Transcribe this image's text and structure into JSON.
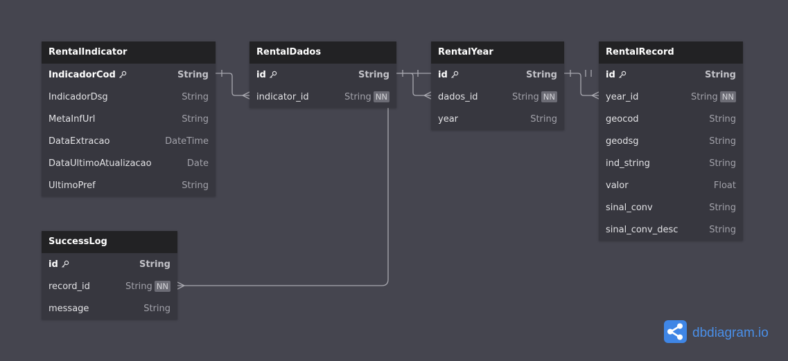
{
  "tables": [
    {
      "name": "RentalIndicator",
      "fields": [
        {
          "name": "IndicadorCod",
          "type": "String",
          "pk": true
        },
        {
          "name": "IndicadorDsg",
          "type": "String"
        },
        {
          "name": "MetaInfUrl",
          "type": "String"
        },
        {
          "name": "DataExtracao",
          "type": "DateTime"
        },
        {
          "name": "DataUltimoAtualizacao",
          "type": "Date"
        },
        {
          "name": "UltimoPref",
          "type": "String"
        }
      ]
    },
    {
      "name": "RentalDados",
      "fields": [
        {
          "name": "id",
          "type": "String",
          "pk": true
        },
        {
          "name": "indicator_id",
          "type": "String",
          "nn": "NN"
        }
      ]
    },
    {
      "name": "RentalYear",
      "fields": [
        {
          "name": "id",
          "type": "String",
          "pk": true
        },
        {
          "name": "dados_id",
          "type": "String",
          "nn": "NN"
        },
        {
          "name": "year",
          "type": "String"
        }
      ]
    },
    {
      "name": "RentalRecord",
      "fields": [
        {
          "name": "id",
          "type": "String",
          "pk": true
        },
        {
          "name": "year_id",
          "type": "String",
          "nn": "NN"
        },
        {
          "name": "geocod",
          "type": "String"
        },
        {
          "name": "geodsg",
          "type": "String"
        },
        {
          "name": "ind_string",
          "type": "String"
        },
        {
          "name": "valor",
          "type": "Float"
        },
        {
          "name": "sinal_conv",
          "type": "String"
        },
        {
          "name": "sinal_conv_desc",
          "type": "String"
        }
      ]
    },
    {
      "name": "SuccessLog",
      "fields": [
        {
          "name": "id",
          "type": "String",
          "pk": true
        },
        {
          "name": "record_id",
          "type": "String",
          "nn": "NN"
        },
        {
          "name": "message",
          "type": "String"
        }
      ]
    }
  ],
  "relationships": [
    {
      "from": "RentalIndicator.IndicadorCod",
      "to": "RentalDados.indicator_id",
      "cardinality": "one-to-many"
    },
    {
      "from": "RentalDados.id",
      "to": "RentalYear.dados_id",
      "cardinality": "one-to-many"
    },
    {
      "from": "RentalYear.id",
      "to": "RentalRecord.year_id",
      "cardinality": "one-to-many"
    },
    {
      "from": "RentalDados.id",
      "to": "SuccessLog.record_id",
      "cardinality": "one-to-many"
    }
  ],
  "brand": {
    "name": "dbdiagram.io",
    "icon": "share-nodes-icon",
    "color": "#4a8fe8"
  },
  "colors": {
    "background": "#45454f",
    "header": "#222224",
    "table_body": "#37373f",
    "connector": "#a9a9b0"
  }
}
